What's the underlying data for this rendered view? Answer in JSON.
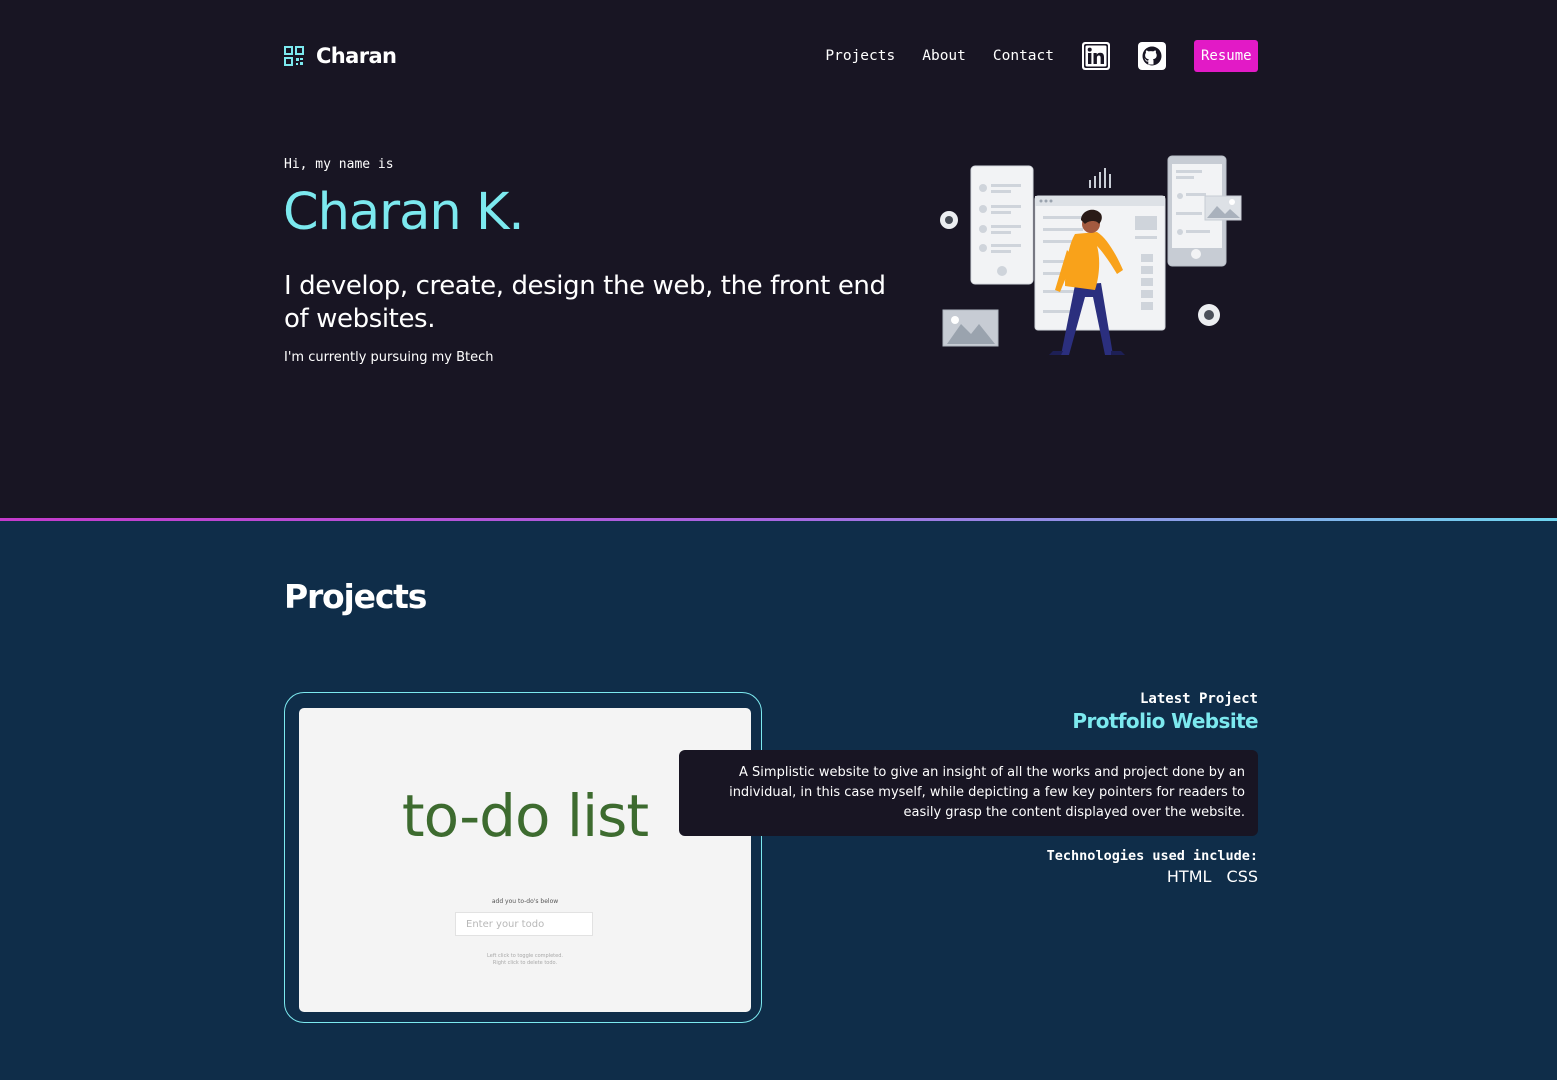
{
  "brand": {
    "logo_icon": "grid-qr-icon",
    "name": "Charan"
  },
  "nav": {
    "links": [
      "Projects",
      "About",
      "Contact"
    ],
    "icons": [
      "linkedin-icon",
      "github-icon"
    ],
    "resume_label": "Resume"
  },
  "hero": {
    "greeting": "Hi, my name is",
    "name": "Charan K.",
    "tagline": "I develop, create, design the web, the front end of websites.",
    "subtext": "I'm currently pursuing my Btech"
  },
  "projects": {
    "heading": "Projects",
    "latest_label": "Latest Project",
    "title": "Protfolio Website",
    "description": "A Simplistic website to give an insight of all the works and project done by an individual, in this case myself, while depicting a few key pointers for readers to easily grasp the content displayed over the website.",
    "tech_label": "Technologies used include:",
    "technologies": [
      "HTML",
      "CSS"
    ],
    "preview": {
      "title": "to-do list",
      "prompt": "add you to-do's below",
      "input_placeholder": "Enter your todo",
      "hint_line1": "Left click to toggle completed.",
      "hint_line2": "Right click to delete todo."
    }
  },
  "colors": {
    "background": "#181523",
    "projects_background": "#0f2d49",
    "accent_cyan": "#7ce9ef",
    "accent_magenta": "#e21ac6",
    "todo_green": "#3d6b2f"
  }
}
